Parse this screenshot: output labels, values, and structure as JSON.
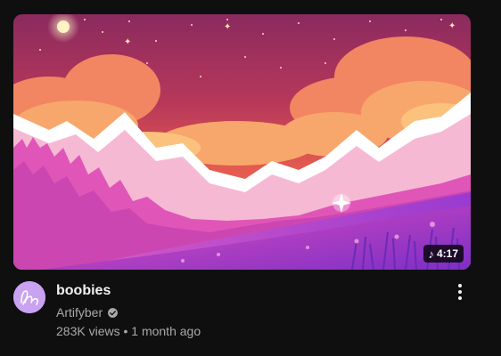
{
  "video": {
    "title": "boobies",
    "channel": "Artifyber",
    "views": "283K views",
    "separator": "•",
    "age": "1 month ago",
    "stats_text": "283K views • 1 month ago",
    "duration": "4:17",
    "duration_icon": "music-note-icon",
    "channel_verified_icon": "verified-badge-icon",
    "menu_icon": "more-vertical-icon"
  },
  "colors": {
    "background": "#0f0f0f",
    "title": "#f1f1f1",
    "secondary_text": "#aaaaaa",
    "avatar_bg": "#c9a2f2"
  }
}
